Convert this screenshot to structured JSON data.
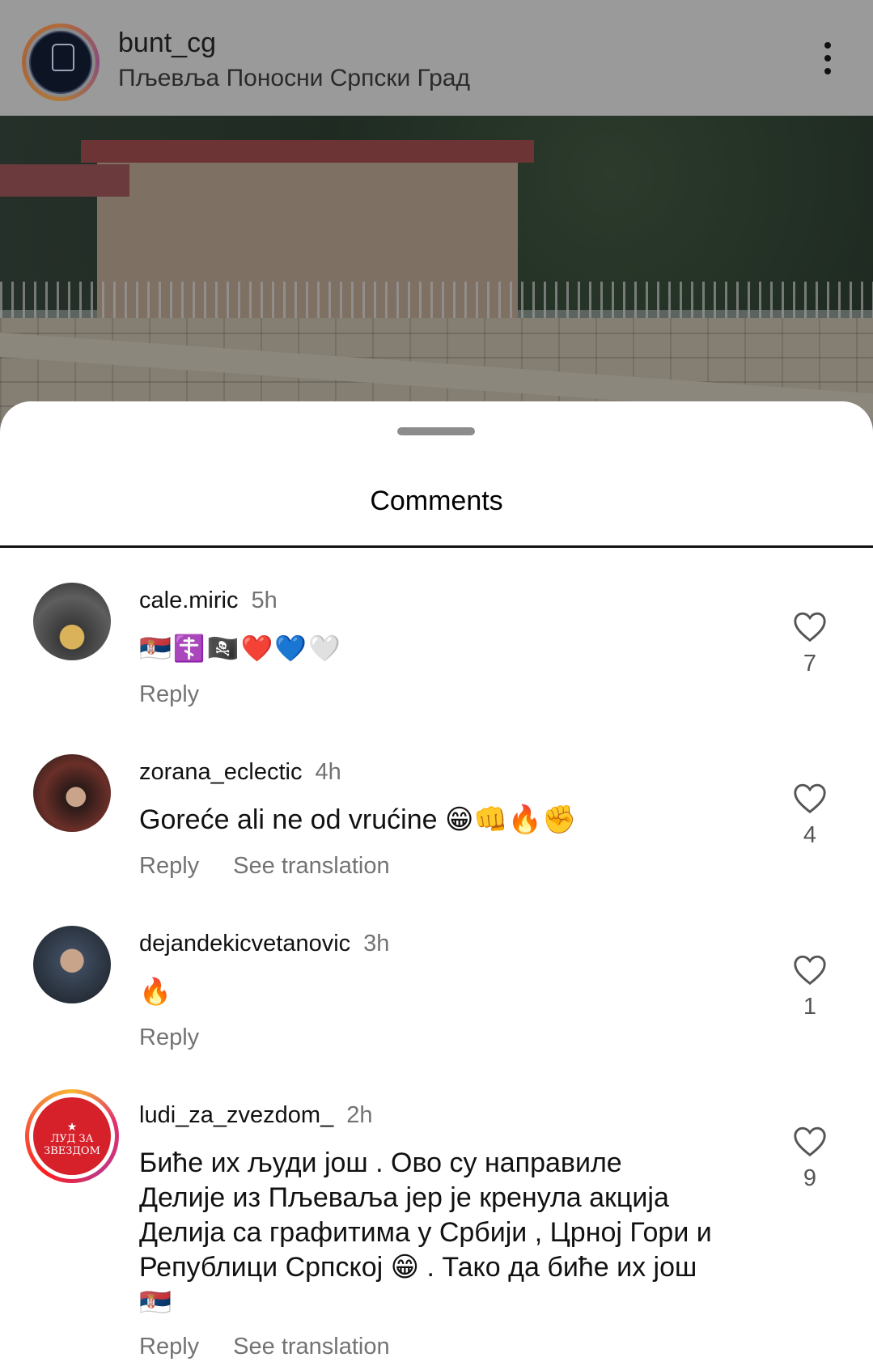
{
  "post": {
    "username": "bunt_cg",
    "location": "Пљевља Поносни Српски Град",
    "avatar_icon": "fist-logo-icon",
    "menu_icon": "more-vertical-icon"
  },
  "sheet": {
    "title": "Comments"
  },
  "comments": [
    {
      "username": "cale.miric",
      "time": "5h",
      "text": "🇷🇸☦️🏴‍☠️❤️💙🤍",
      "reply_label": "Reply",
      "likes": "7"
    },
    {
      "username": "zorana_eclectic",
      "time": "4h",
      "text": "Goreće ali ne od vrućine 😁👊🔥✊",
      "reply_label": "Reply",
      "translate_label": "See translation",
      "likes": "4"
    },
    {
      "username": "dejandekicvetanovic",
      "time": "3h",
      "text": "🔥",
      "reply_label": "Reply",
      "likes": "1"
    },
    {
      "username": "ludi_za_zvezdom_",
      "time": "2h",
      "text_lines": [
        "Биће их људи још . Ово су направиле",
        "Делије из Пљеваља јер је кренула акција",
        "Делија са графитима у Србији , Црној Гори и",
        "Републици Српској 😁 . Тако да биће их још",
        "🇷🇸"
      ],
      "avatar_text_top": "ЛУД ЗА",
      "avatar_text_bottom": "ЗВЕЗДОМ",
      "reply_label": "Reply",
      "translate_label": "See translation",
      "likes": "9"
    }
  ],
  "colors": {
    "accent_text": "#111111",
    "muted_text": "#737373",
    "sheet_bg": "#ffffff",
    "dim_overlay": "#7a7a7a"
  }
}
